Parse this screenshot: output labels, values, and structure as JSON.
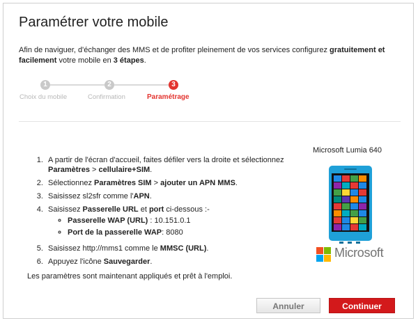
{
  "dialog": {
    "title": "Paramétrer votre mobile",
    "intro": {
      "part1": "Afin de naviguer, d'échanger des MMS et de profiter pleinement de vos services configurez ",
      "bold1": "gratuitement et facilement",
      "part2": " votre mobile en ",
      "bold2": "3 étapes",
      "part3": "."
    }
  },
  "stepper": {
    "steps": [
      {
        "number": "1",
        "label": "Choix du mobile",
        "state": "done"
      },
      {
        "number": "2",
        "label": "Confirmation",
        "state": "done"
      },
      {
        "number": "3",
        "label": "Paramétrage",
        "state": "active"
      }
    ]
  },
  "instructions": {
    "items": [
      {
        "a": "A partir de l'écran d'accueil, faites défiler vers la droite et sélectionnez ",
        "b": "Paramètres",
        "c": " > ",
        "d": "cellulaire+SIM",
        "e": "."
      },
      {
        "a": "Sélectionnez ",
        "b": "Paramètres SIM",
        "c": " > ",
        "d": "ajouter un APN MMS",
        "e": "."
      },
      {
        "a": "Saisissez sl2sfr comme l'",
        "b": "APN",
        "c": "."
      },
      {
        "a": "Saisissez ",
        "b": "Passerelle URL",
        "c": " et ",
        "d": "port",
        "e": " ci-dessous :-"
      },
      {
        "a": "Saisissez http://mms1 comme le ",
        "b": "MMSC (URL)",
        "c": "."
      },
      {
        "a": "Appuyez l'icône ",
        "b": "Sauvegarder",
        "c": "."
      }
    ],
    "subitems": [
      {
        "label": "Passerelle WAP (URL)",
        "value": ": 10.151.0.1"
      },
      {
        "label": "Port de la passerelle WAP",
        "value": ": 8080"
      }
    ],
    "footer": "Les paramètres sont maintenant appliqués et prêt à l'emploi."
  },
  "device": {
    "name": "Microsoft Lumia 640",
    "brand": "Microsoft",
    "tile_colors": [
      "#1e88e5",
      "#e53935",
      "#43a047",
      "#fb8c00",
      "#8e24aa",
      "#00acc1",
      "#e53935",
      "#1e88e5",
      "#43a047",
      "#fdd835",
      "#1e88e5",
      "#e53935",
      "#00897b",
      "#5e35b1",
      "#fb8c00",
      "#1e88e5",
      "#e53935",
      "#43a047",
      "#1e88e5",
      "#8e24aa",
      "#fb8c00",
      "#00acc1",
      "#43a047",
      "#1e88e5",
      "#e53935",
      "#1e88e5",
      "#fdd835",
      "#43a047",
      "#8e24aa",
      "#1e88e5",
      "#e53935",
      "#00acc1"
    ],
    "logo_colors": [
      "#f25022",
      "#7fba00",
      "#00a4ef",
      "#ffb900"
    ]
  },
  "buttons": {
    "cancel": "Annuler",
    "continue": "Continuer"
  }
}
